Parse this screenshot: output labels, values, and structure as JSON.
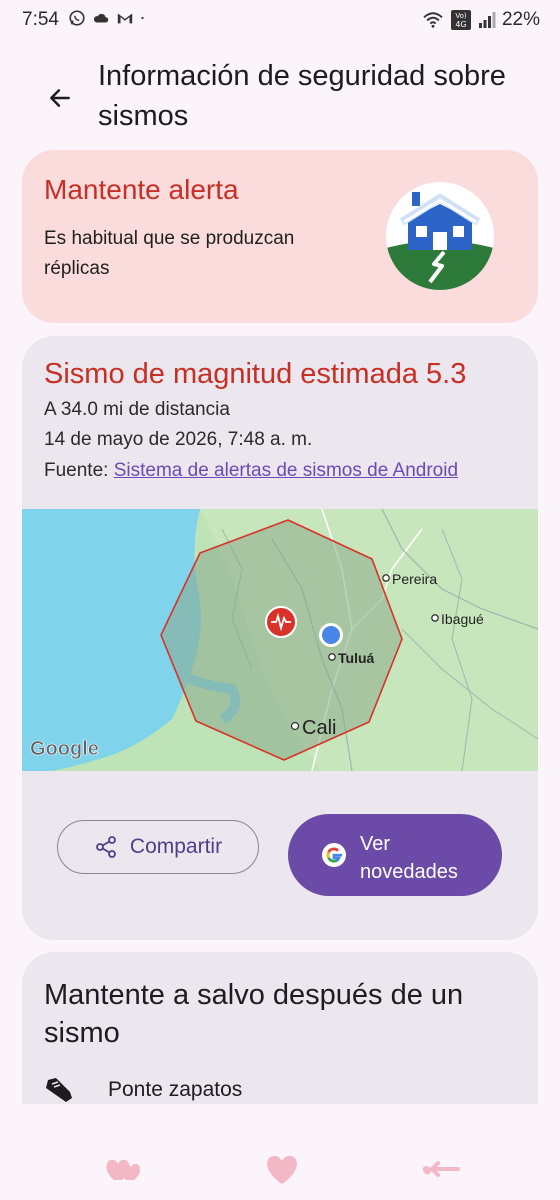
{
  "status": {
    "time": "7:54",
    "battery": "22%",
    "network_badge_top": "Vo)",
    "network_badge_bottom": "4G"
  },
  "header": {
    "title": "Información de seguridad sobre sismos"
  },
  "alert": {
    "title": "Mantente alerta",
    "text": "Es habitual que se produzcan réplicas"
  },
  "quake": {
    "title": "Sismo de magnitud estimada 5.3",
    "distance": "A 34.0 mi de distancia",
    "datetime": "14 de mayo de 2026, 7:48 a. m.",
    "source_prefix": "Fuente:",
    "source_link": "Sistema de alertas de sismos de Android",
    "map": {
      "cities": [
        "Pereira",
        "Ibagué",
        "Tuluá",
        "Cali"
      ],
      "attribution": "Google"
    },
    "share_label": "Compartir",
    "news_label": "Ver novedades"
  },
  "safety": {
    "title": "Mantente a salvo después de un sismo",
    "item_label": "Ponte zapatos"
  },
  "colors": {
    "accent_red": "#c72f24",
    "purple": "#6b4aa8",
    "card_bg": "#ece6ee",
    "alert_bg": "#fbdcdc"
  }
}
